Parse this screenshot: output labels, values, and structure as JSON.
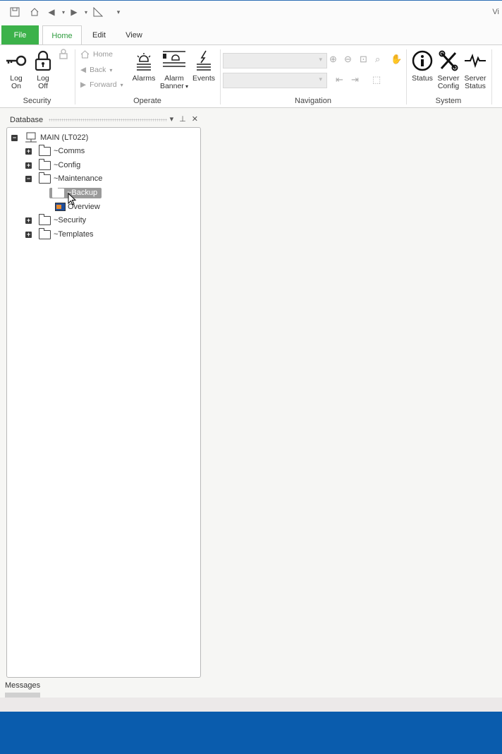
{
  "app": {
    "title_fragment": "Vi"
  },
  "quick_access": [
    "save-icon",
    "home-icon",
    "back-icon",
    "forward-icon",
    "ruler-icon",
    "customize-icon"
  ],
  "tabs": {
    "file": "File",
    "home": "Home",
    "edit": "Edit",
    "view": "View"
  },
  "ribbon": {
    "security": {
      "label": "Security",
      "log_on": "Log\nOn",
      "log_off": "Log\nOff"
    },
    "operate": {
      "label": "Operate",
      "home": "Home",
      "back": "Back",
      "forward": "Forward",
      "alarms": "Alarms",
      "alarm_banner": "Alarm\nBanner",
      "events": "Events"
    },
    "navigation": {
      "label": "Navigation"
    },
    "system": {
      "label": "System",
      "status": "Status",
      "server_config": "Server\nConfig",
      "server_status": "Server\nStatus"
    }
  },
  "panel": {
    "title": "Database",
    "tree": [
      {
        "label": "MAIN (LT022)",
        "expanded": true
      },
      {
        "label": "~Comms",
        "expanded": false
      },
      {
        "label": "~Config",
        "expanded": false
      },
      {
        "label": "~Maintenance",
        "expanded": true
      },
      {
        "label": "~Backup",
        "selected": true
      },
      {
        "label": "Overview"
      },
      {
        "label": "~Security",
        "expanded": false
      },
      {
        "label": "~Templates",
        "expanded": false
      }
    ]
  },
  "messages": {
    "label": "Messages"
  },
  "colors": {
    "file_tab": "#3cb24a",
    "taskbar": "#0a5cad",
    "home_tab_text": "#2e9c3e"
  }
}
